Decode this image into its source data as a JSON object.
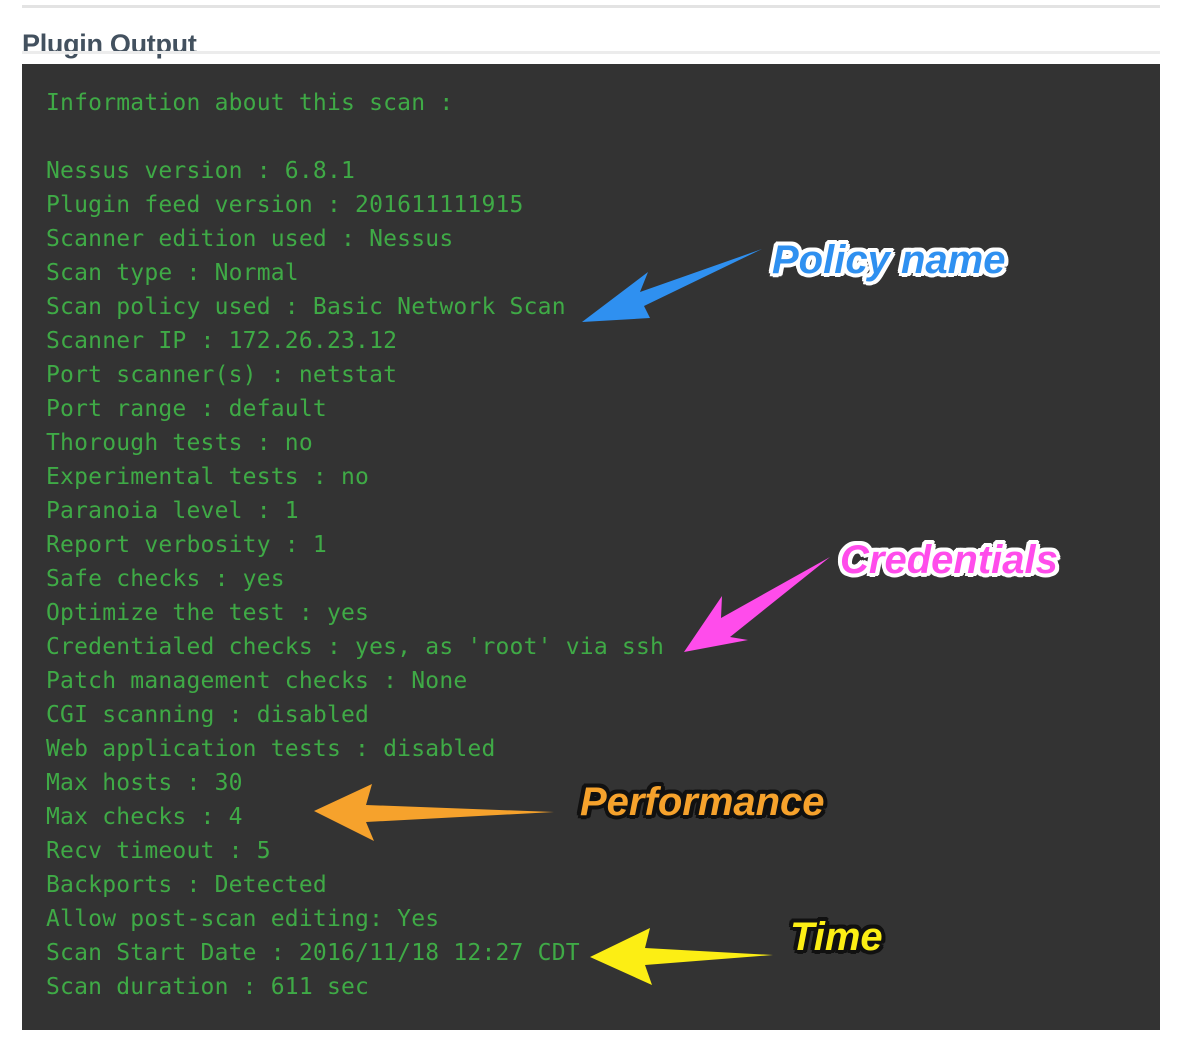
{
  "header": {
    "title": "Plugin Output"
  },
  "console": {
    "background_color": "#333333",
    "text_color": "#3faa46",
    "lines": [
      "Information about this scan :",
      "",
      "Nessus version : 6.8.1",
      "Plugin feed version : 201611111915",
      "Scanner edition used : Nessus",
      "Scan type : Normal",
      "Scan policy used : Basic Network Scan",
      "Scanner IP : 172.26.23.12",
      "Port scanner(s) : netstat",
      "Port range : default",
      "Thorough tests : no",
      "Experimental tests : no",
      "Paranoia level : 1",
      "Report verbosity : 1",
      "Safe checks : yes",
      "Optimize the test : yes",
      "Credentialed checks : yes, as 'root' via ssh",
      "Patch management checks : None",
      "CGI scanning : disabled",
      "Web application tests : disabled",
      "Max hosts : 30",
      "Max checks : 4",
      "Recv timeout : 5",
      "Backports : Detected",
      "Allow post-scan editing: Yes",
      "Scan Start Date : 2016/11/18 12:27 CDT",
      "Scan duration : 611 sec"
    ],
    "scan_info": {
      "nessus_version": "6.8.1",
      "plugin_feed_version": "201611111915",
      "scanner_edition_used": "Nessus",
      "scan_type": "Normal",
      "scan_policy_used": "Basic Network Scan",
      "scanner_ip": "172.26.23.12",
      "port_scanners": "netstat",
      "port_range": "default",
      "thorough_tests": "no",
      "experimental_tests": "no",
      "paranoia_level": "1",
      "report_verbosity": "1",
      "safe_checks": "yes",
      "optimize_the_test": "yes",
      "credentialed_checks": "yes, as 'root' via ssh",
      "patch_management_checks": "None",
      "cgi_scanning": "disabled",
      "web_application_tests": "disabled",
      "max_hosts": "30",
      "max_checks": "4",
      "recv_timeout": "5",
      "backports": "Detected",
      "allow_post_scan_editing": "Yes",
      "scan_start_date": "2016/11/18 12:27 CDT",
      "scan_duration": "611 sec"
    }
  },
  "annotations": [
    {
      "id": "policy-name",
      "label": "Policy name",
      "color": "#2f90f0",
      "outline_color": "#ffffff",
      "points_to": "Scan policy used : Basic Network Scan"
    },
    {
      "id": "credentials",
      "label": "Credentials",
      "color": "#ff4ceb",
      "outline_color": "#ffffff",
      "points_to": "Credentialed checks : yes, as 'root' via ssh"
    },
    {
      "id": "performance",
      "label": "Performance",
      "color": "#f6a22c",
      "outline_color": "#111111",
      "points_to": "Max hosts : 30 / Max checks : 4"
    },
    {
      "id": "time",
      "label": "Time",
      "color": "#fcee14",
      "outline_color": "#111111",
      "points_to": "Scan Start Date : 2016/11/18 12:27 CDT"
    }
  ]
}
